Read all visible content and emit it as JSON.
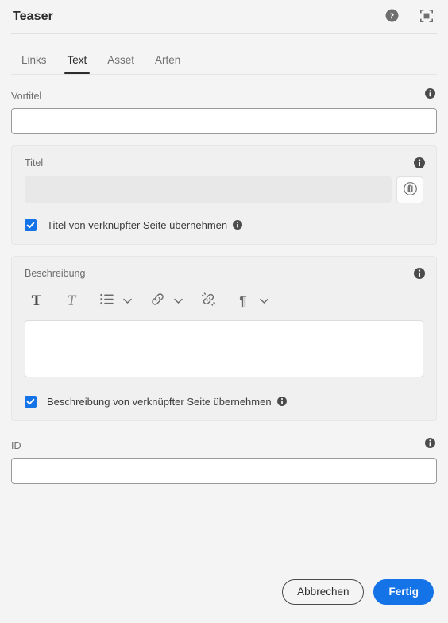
{
  "dialog": {
    "title": "Teaser",
    "help_icon": "help-circle-icon",
    "fullscreen_icon": "fullscreen-icon"
  },
  "tabs": [
    {
      "label": "Links",
      "active": false
    },
    {
      "label": "Text",
      "active": true
    },
    {
      "label": "Asset",
      "active": false
    },
    {
      "label": "Arten",
      "active": false
    }
  ],
  "fields": {
    "vortitel": {
      "label": "Vortitel",
      "value": "",
      "placeholder": "",
      "info_icon": "info-icon"
    },
    "titel": {
      "label": "Titel",
      "value": "",
      "placeholder": "",
      "info_icon": "info-icon",
      "inherit_button_icon": "inherit-link-icon",
      "checkbox": {
        "label": "Titel von verknüpfter Seite übernehmen",
        "checked": true,
        "info_icon": "info-icon"
      }
    },
    "beschreibung": {
      "label": "Beschreibung",
      "value": "",
      "placeholder": "",
      "info_icon": "info-icon",
      "toolbar": [
        {
          "name": "bold",
          "glyph": "T"
        },
        {
          "name": "italic",
          "glyph": "T"
        },
        {
          "name": "bullet-list",
          "glyph": "list"
        },
        {
          "name": "bullet-list-options",
          "glyph": "chevron-down"
        },
        {
          "name": "hyperlink",
          "glyph": "link"
        },
        {
          "name": "hyperlink-options",
          "glyph": "chevron-down"
        },
        {
          "name": "unlink",
          "glyph": "unlink"
        },
        {
          "name": "paragraph-format",
          "glyph": "¶"
        },
        {
          "name": "paragraph-format-options",
          "glyph": "chevron-down"
        }
      ],
      "checkbox": {
        "label": "Beschreibung von verknüpfter Seite übernehmen",
        "checked": true,
        "info_icon": "info-icon"
      }
    },
    "id": {
      "label": "ID",
      "value": "",
      "placeholder": "",
      "info_icon": "info-icon"
    }
  },
  "footer": {
    "cancel_label": "Abbrechen",
    "done_label": "Fertig"
  },
  "colors": {
    "accent": "#1473E6",
    "page_bg": "#F4F4F4",
    "panel_bg": "#F0F0F0",
    "text": "#2C2C2C",
    "muted_text": "#6E6E6E"
  }
}
